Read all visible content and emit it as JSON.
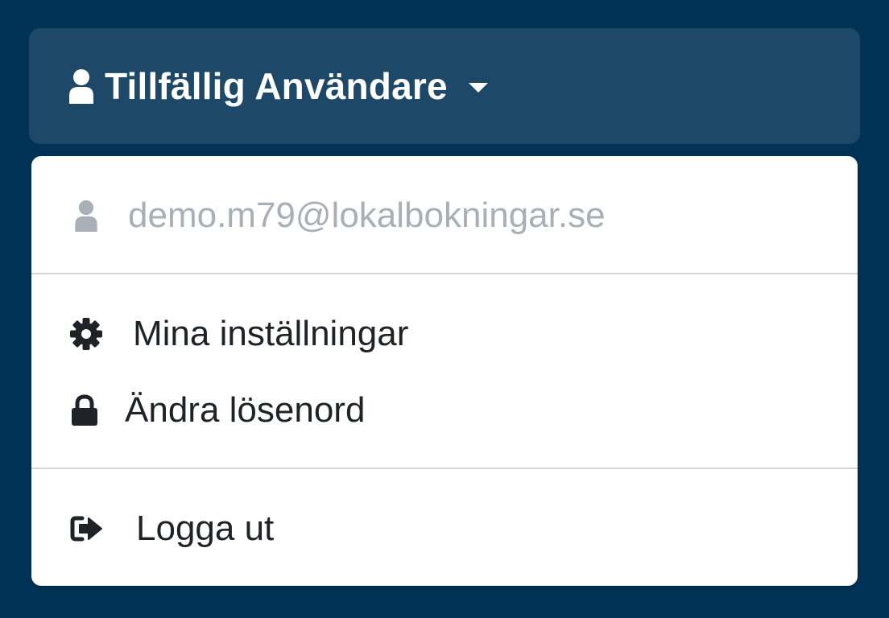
{
  "user_menu": {
    "toggle_label": "Tillfällig Användare",
    "toggle_icon": "user-icon",
    "caret_icon": "caret-down-icon"
  },
  "dropdown": {
    "email": "demo.m79@lokalbokningar.se",
    "email_icon": "user-icon",
    "items": [
      {
        "label": "Mina inställningar",
        "icon": "gear-icon"
      },
      {
        "label": "Ändra lösenord",
        "icon": "lock-icon"
      },
      {
        "label": "Logga ut",
        "icon": "sign-out-icon"
      }
    ]
  },
  "colors": {
    "background": "#023356",
    "toggle_background": "#1e4868",
    "menu_background": "#ffffff",
    "muted_text": "#a8afb6",
    "text": "#1f2327"
  }
}
